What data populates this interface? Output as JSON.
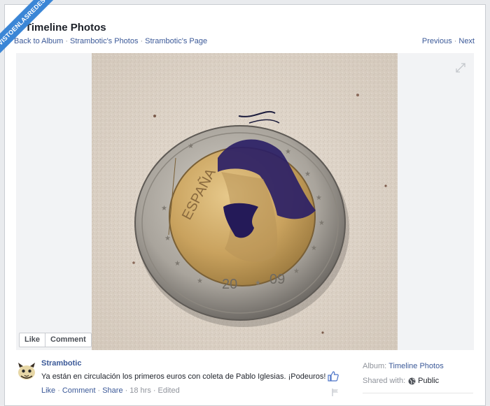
{
  "header": {
    "title": "Timeline Photos",
    "breadcrumbs": [
      "Back to Album",
      "Strambotic's Photos",
      "Strambotic's Page"
    ],
    "separator": "·",
    "pager": {
      "previous": "Previous",
      "next": "Next"
    }
  },
  "photo": {
    "coin_country": "ESPAÑA",
    "coin_year_left": "20",
    "coin_year_right": "09"
  },
  "photo_actions": {
    "like": "Like",
    "comment": "Comment"
  },
  "post": {
    "author": "Strambotic",
    "caption": "Ya están en circulación los primeros euros con coleta de Pablo Iglesias. ¡Podeuros!",
    "actions": [
      "Like",
      "Comment",
      "Share"
    ],
    "time": "18 hrs",
    "edited": "Edited"
  },
  "sidebar": {
    "album_label": "Album:",
    "album_name": "Timeline Photos",
    "shared_label": "Shared with:",
    "privacy": "Public"
  },
  "watermark": {
    "text": "VISTOENLASREDES"
  },
  "colors": {
    "link": "#3b5998",
    "watermark": "#3b86d6",
    "muted": "#90949c"
  }
}
